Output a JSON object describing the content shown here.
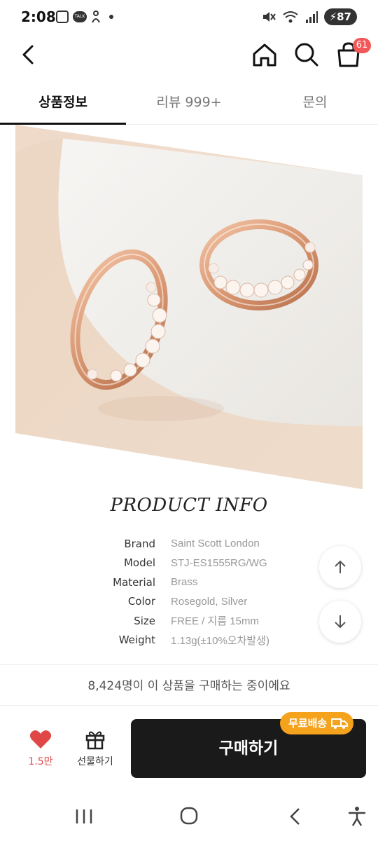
{
  "status_bar": {
    "time": "2:08",
    "battery": "87",
    "talk_label": "TALK"
  },
  "header": {
    "cart_badge": "61"
  },
  "tabs": [
    {
      "label": "상품정보",
      "active": true
    },
    {
      "label": "리뷰 999+",
      "active": false
    },
    {
      "label": "문의",
      "active": false
    }
  ],
  "product_info": {
    "title": "PRODUCT INFO",
    "rows": [
      {
        "label": "Brand",
        "value": "Saint Scott London"
      },
      {
        "label": "Model",
        "value": "STJ-ES1555RG/WG"
      },
      {
        "label": "Material",
        "value": "Brass"
      },
      {
        "label": "Color",
        "value": "Rosegold, Silver"
      },
      {
        "label": "Size",
        "value": "FREE / 지름 15mm"
      },
      {
        "label": "Weight",
        "value": "1.13g(±10%오차발생)"
      }
    ]
  },
  "buyers_text": "8,424명이 이 상품을 구매하는 중이에요",
  "bottom_bar": {
    "like_count": "1.5만",
    "gift_label": "선물하기",
    "buy_label": "구매하기",
    "free_shipping_label": "무료배송"
  },
  "colors": {
    "accent_red": "#e04848",
    "badge_red": "#f25858",
    "shipping_orange": "#f5a21c",
    "buy_button": "#1a1a1a"
  },
  "icons": [
    "back-arrow-icon",
    "home-icon",
    "search-icon",
    "cart-icon",
    "arrow-up-icon",
    "arrow-down-icon",
    "heart-icon",
    "gift-icon",
    "truck-icon",
    "recent-apps-icon",
    "home-circle-icon",
    "nav-back-icon",
    "accessibility-icon"
  ]
}
